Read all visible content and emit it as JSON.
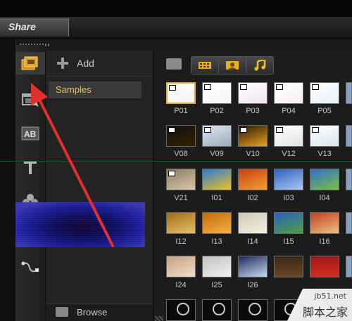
{
  "header": {
    "tab_label": "Share"
  },
  "library": {
    "add_label": "Add",
    "folders": [
      "Samples"
    ],
    "browse_label": "Browse"
  },
  "toolbar": {
    "tools": [
      "media-icon",
      "transition-icon",
      "title-overlay-icon",
      "text-icon",
      "effects-icon",
      "motion-path-icon"
    ]
  },
  "gallery": {
    "view_buttons": [
      "video-filter-icon",
      "photo-filter-icon",
      "audio-filter-icon"
    ],
    "rows": [
      [
        "P01",
        "P02",
        "P03",
        "P04",
        "P05"
      ],
      [
        "V08",
        "V09",
        "V10",
        "V12",
        "V13"
      ],
      [
        "V21",
        "I01",
        "I02",
        "I03",
        "I04"
      ],
      [
        "I12",
        "I13",
        "I14",
        "I15",
        "I16"
      ],
      [
        "I24",
        "I25",
        "I26",
        "",
        ""
      ]
    ],
    "selected": "P01"
  },
  "watermark": {
    "site": "jb51.net",
    "name": "脚本之家"
  }
}
